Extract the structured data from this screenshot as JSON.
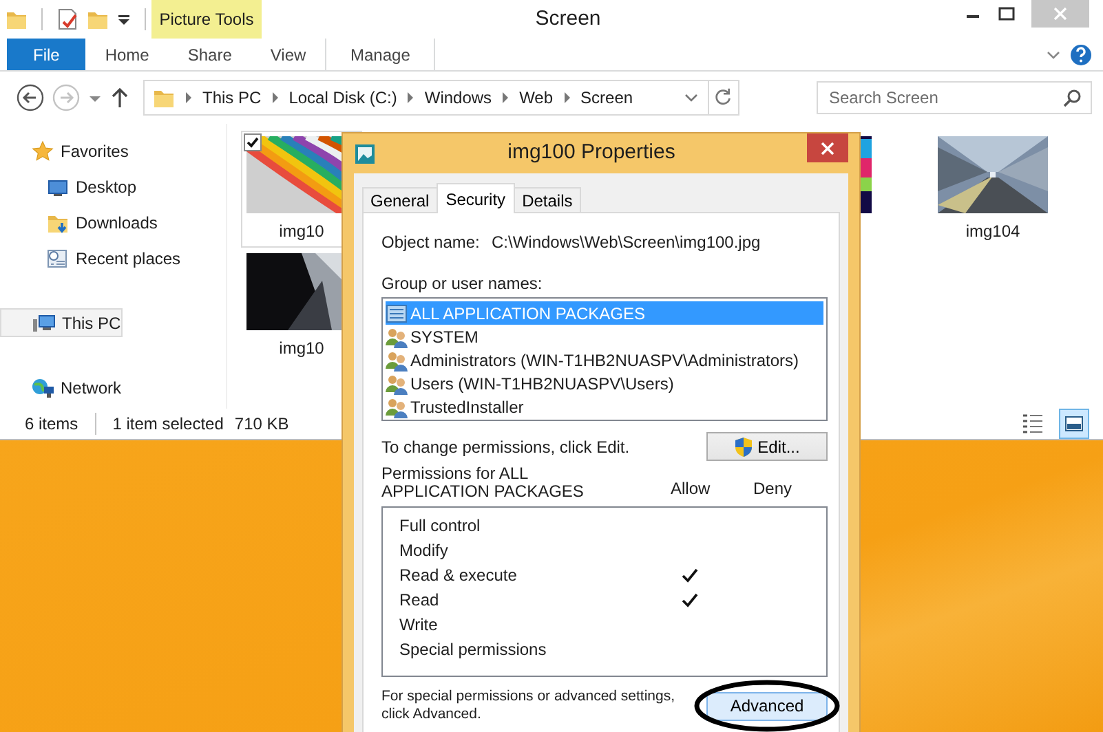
{
  "explorer": {
    "title": "Screen",
    "contextual_group": "Picture Tools",
    "ribbon_tabs": [
      {
        "label": "File",
        "kind": "file",
        "selected": false
      },
      {
        "label": "Home",
        "kind": "normal",
        "selected": false
      },
      {
        "label": "Share",
        "kind": "normal",
        "selected": false
      },
      {
        "label": "View",
        "kind": "normal",
        "selected": false
      },
      {
        "label": "Manage",
        "kind": "contextual",
        "selected": false
      }
    ],
    "breadcrumb": [
      "This PC",
      "Local Disk (C:)",
      "Windows",
      "Web",
      "Screen"
    ],
    "search": {
      "placeholder": "Search Screen"
    },
    "navigation": [
      {
        "label": "Favorites",
        "kind": "star",
        "selected": false,
        "children": [
          {
            "label": "Desktop",
            "kind": "desktop",
            "selected": false
          },
          {
            "label": "Downloads",
            "kind": "downloads",
            "selected": false
          },
          {
            "label": "Recent places",
            "kind": "recent",
            "selected": false
          }
        ]
      },
      {
        "label": "This PC",
        "kind": "computer",
        "selected": true
      },
      {
        "label": "Network",
        "kind": "network",
        "selected": false
      }
    ],
    "files": [
      {
        "name": "img10",
        "selected": true,
        "kind": "stripes"
      },
      {
        "selected": false,
        "kind": "blocks"
      },
      {
        "name": "img104",
        "selected": false,
        "kind": "tunnel"
      },
      {
        "name": "img10",
        "selected": false,
        "kind": "dark"
      }
    ],
    "status": {
      "count": "6 items",
      "selection": "1 item selected",
      "size": "710 KB"
    },
    "view_buttons": [
      {
        "kind": "details",
        "selected": false
      },
      {
        "kind": "thumbnails",
        "selected": true
      }
    ]
  },
  "dialog": {
    "title": "img100 Properties",
    "tabs": [
      {
        "label": "General",
        "selected": false
      },
      {
        "label": "Security",
        "selected": true
      },
      {
        "label": "Details",
        "selected": false
      }
    ],
    "object_name_label": "Object name:",
    "object_name": "C:\\Windows\\Web\\Screen\\img100.jpg",
    "groups_label": "Group or user names:",
    "groups": [
      {
        "name": "ALL APPLICATION PACKAGES",
        "kind": "package",
        "selected": true
      },
      {
        "name": "SYSTEM",
        "kind": "users",
        "selected": false
      },
      {
        "name": "Administrators (WIN-T1HB2NUASPV\\Administrators)",
        "kind": "users",
        "selected": false
      },
      {
        "name": "Users (WIN-T1HB2NUASPV\\Users)",
        "kind": "users",
        "selected": false
      },
      {
        "name": "TrustedInstaller",
        "kind": "users",
        "selected": false
      }
    ],
    "edit_hint": "To change permissions, click Edit.",
    "edit_button": "Edit...",
    "permissions_label": "Permissions for ALL APPLICATION PACKAGES",
    "allow_header": "Allow",
    "deny_header": "Deny",
    "permissions": [
      {
        "name": "Full control",
        "allow": false
      },
      {
        "name": "Modify",
        "allow": false
      },
      {
        "name": "Read & execute",
        "allow": true
      },
      {
        "name": "Read",
        "allow": true
      },
      {
        "name": "Write",
        "allow": false
      },
      {
        "name": "Special permissions",
        "allow": false
      }
    ],
    "advanced_hint": "For special permissions or advanced settings, click Advanced.",
    "advanced_button": "Advanced"
  }
}
